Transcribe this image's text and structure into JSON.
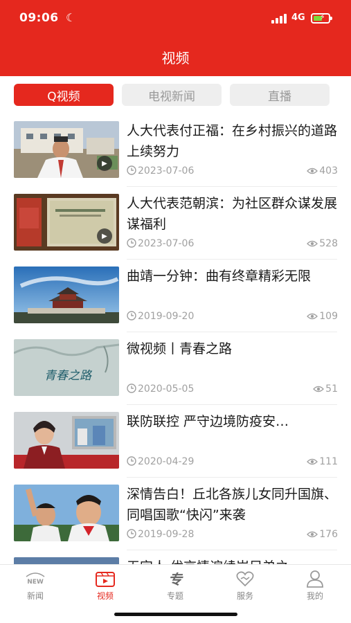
{
  "status_bar": {
    "time": "09:06",
    "network": "4G"
  },
  "header": {
    "title": "视频"
  },
  "tabs": [
    {
      "label": "Q视频",
      "active": true
    },
    {
      "label": "电视新闻",
      "active": false
    },
    {
      "label": "直播",
      "active": false
    }
  ],
  "videos": [
    {
      "title": "人大代表付正福：在乡村振兴的道路上续努力",
      "date": "2023-07-06",
      "views": "403",
      "has_play": true
    },
    {
      "title": "人大代表范朝滨：为社区群众谋发展 谋福利",
      "date": "2023-07-06",
      "views": "528",
      "has_play": true
    },
    {
      "title": "曲靖一分钟：曲有终章精彩无限",
      "date": "2019-09-20",
      "views": "109",
      "has_play": false
    },
    {
      "title": "微视频丨青春之路",
      "date": "2020-05-05",
      "views": "51",
      "has_play": false,
      "thumb_text": "青春之路"
    },
    {
      "title": "联防联控 严守边境防疫安…",
      "date": "2020-04-29",
      "views": "111",
      "has_play": false
    },
    {
      "title": "深情告白！丘北各族儿女同升国旗、同唱国歌“快闪”来袭",
      "date": "2019-09-28",
      "views": "176",
      "has_play": false
    },
    {
      "title": "无完人 优京情谊续岩兄弟之",
      "date": "",
      "views": "",
      "has_play": false
    }
  ],
  "bottom_nav": [
    {
      "label": "新闻",
      "icon": "news-icon",
      "active": false,
      "icon_text": "NEW"
    },
    {
      "label": "视频",
      "icon": "video-icon",
      "active": true
    },
    {
      "label": "专题",
      "icon": "topic-icon",
      "active": false,
      "icon_text": "专"
    },
    {
      "label": "服务",
      "icon": "service-icon",
      "active": false
    },
    {
      "label": "我的",
      "icon": "profile-icon",
      "active": false
    }
  ],
  "colors": {
    "brand_red": "#e5281e",
    "meta_gray": "#a0a0a0"
  }
}
